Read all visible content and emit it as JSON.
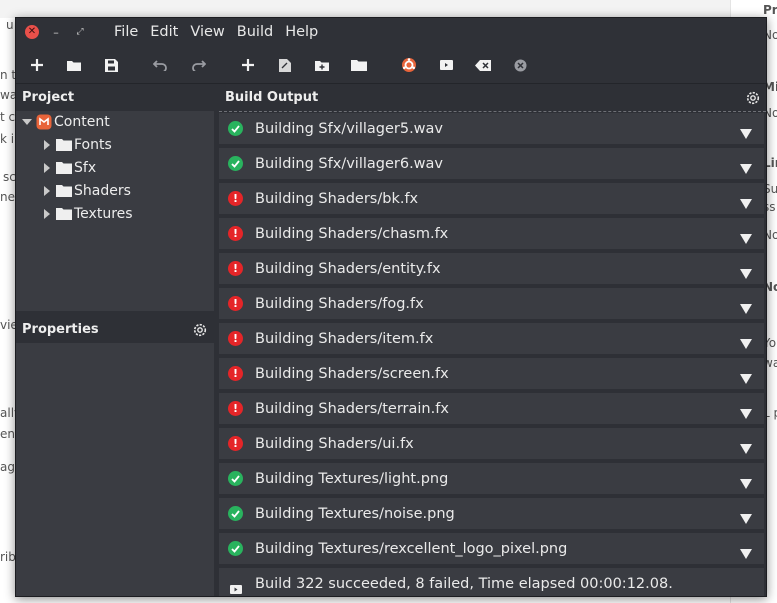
{
  "background": {
    "left_fragments": [
      "u",
      "n t",
      "was",
      "t c",
      "k i",
      "sc",
      "ne",
      "vie",
      "ally",
      "ent",
      "ag",
      "ribu"
    ],
    "right_fragments": [
      "Pro",
      "No",
      "Mil",
      "No",
      "Lin",
      "Sus",
      "ss",
      "No",
      "No",
      "You",
      "wa",
      "L p"
    ]
  },
  "window": {
    "menu": [
      "File",
      "Edit",
      "View",
      "Build",
      "Help"
    ],
    "toolbar_icons": [
      "new-file-icon",
      "open-icon",
      "save-icon",
      "undo-icon",
      "redo-icon",
      "add-item-icon",
      "new-item-icon",
      "add-folder-icon",
      "folder-icon",
      "build-icon",
      "rebuild-icon",
      "clean-icon",
      "cancel-build-icon"
    ]
  },
  "project": {
    "title": "Project",
    "root": "Content",
    "children": [
      "Fonts",
      "Sfx",
      "Shaders",
      "Textures"
    ]
  },
  "properties": {
    "title": "Properties"
  },
  "build_output": {
    "title": "Build Output",
    "items": [
      {
        "status": "success",
        "text": "Building Sfx/villager5.wav"
      },
      {
        "status": "success",
        "text": "Building Sfx/villager6.wav"
      },
      {
        "status": "error",
        "text": "Building Shaders/bk.fx"
      },
      {
        "status": "error",
        "text": "Building Shaders/chasm.fx"
      },
      {
        "status": "error",
        "text": "Building Shaders/entity.fx"
      },
      {
        "status": "error",
        "text": "Building Shaders/fog.fx"
      },
      {
        "status": "error",
        "text": "Building Shaders/item.fx"
      },
      {
        "status": "error",
        "text": "Building Shaders/screen.fx"
      },
      {
        "status": "error",
        "text": "Building Shaders/terrain.fx"
      },
      {
        "status": "error",
        "text": "Building Shaders/ui.fx"
      },
      {
        "status": "success",
        "text": "Building Textures/light.png"
      },
      {
        "status": "success",
        "text": "Building Textures/noise.png"
      },
      {
        "status": "success",
        "text": "Building Textures/rexcellent_logo_pixel.png"
      }
    ],
    "summary": "Build 322 succeeded, 8 failed, Time elapsed 00:00:12.08."
  },
  "colors": {
    "success": "#29b35e",
    "error": "#e52528",
    "content_icon": "#e8643a"
  }
}
